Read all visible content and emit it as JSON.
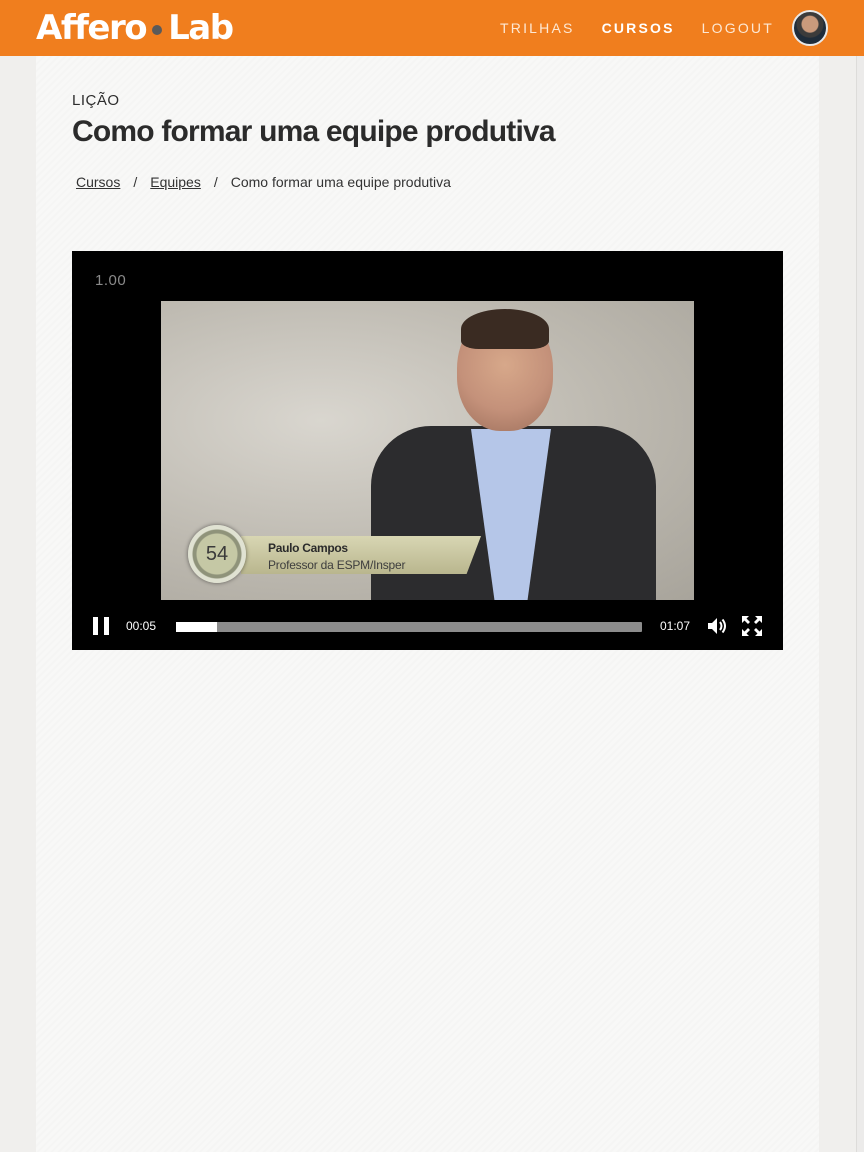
{
  "header": {
    "logo_left": "Affero",
    "logo_right": "Lab",
    "nav": [
      {
        "label": "TRILHAS",
        "active": false
      },
      {
        "label": "CURSOS",
        "active": true
      },
      {
        "label": "LOGOUT",
        "active": false
      }
    ],
    "avatar_icon": "user-avatar",
    "accent_color": "#f07e1e"
  },
  "lesson": {
    "kicker": "LIÇÃO",
    "title": "Como formar uma equipe produtiva"
  },
  "breadcrumb": [
    {
      "label": "Cursos",
      "link": true
    },
    {
      "label": "Equipes",
      "link": true
    },
    {
      "label": "Como formar uma equipe produtiva",
      "link": false
    }
  ],
  "player": {
    "playback_rate": "1.00",
    "overlay_number": "54",
    "overlay_name": "Paulo Campos",
    "overlay_role": "Professor da ESPM/Insper",
    "time_current": "00:05",
    "time_total": "01:07",
    "progress_fraction": 0.088,
    "state_icon": "pause-icon",
    "volume_icon": "volume-icon",
    "fullscreen_icon": "fullscreen-icon"
  }
}
